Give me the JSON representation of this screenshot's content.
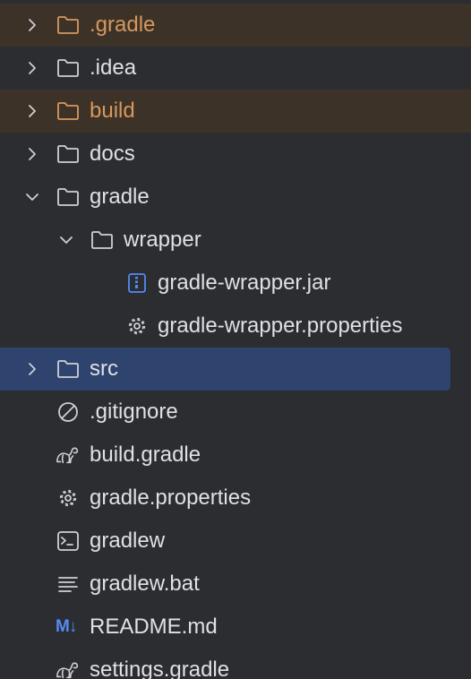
{
  "colors": {
    "background": "#2b2d30",
    "text": "#dfe1e5",
    "excluded_text": "#d6985e",
    "excluded_row": "#3d3228",
    "selected_row": "#2e436e",
    "icon": "#ced0d6",
    "accent": "#548af7"
  },
  "tree": {
    "items": [
      {
        "label": ".gradle",
        "icon": "folder-icon",
        "state": "excluded",
        "expanded": false
      },
      {
        "label": ".idea",
        "icon": "folder-icon",
        "state": "normal",
        "expanded": false
      },
      {
        "label": "build",
        "icon": "folder-icon",
        "state": "excluded",
        "expanded": false
      },
      {
        "label": "docs",
        "icon": "folder-icon",
        "state": "normal",
        "expanded": false
      },
      {
        "label": "gradle",
        "icon": "folder-icon",
        "state": "normal",
        "expanded": true
      },
      {
        "label": "wrapper",
        "icon": "folder-icon",
        "state": "normal",
        "expanded": true
      },
      {
        "label": "gradle-wrapper.jar",
        "icon": "archive-icon",
        "state": "normal"
      },
      {
        "label": "gradle-wrapper.properties",
        "icon": "gear-icon",
        "state": "normal"
      },
      {
        "label": "src",
        "icon": "folder-icon",
        "state": "selected",
        "expanded": false
      },
      {
        "label": ".gitignore",
        "icon": "ignore-icon",
        "state": "normal"
      },
      {
        "label": "build.gradle",
        "icon": "gradle-elephant-icon",
        "state": "normal"
      },
      {
        "label": "gradle.properties",
        "icon": "gear-icon",
        "state": "normal"
      },
      {
        "label": "gradlew",
        "icon": "terminal-icon",
        "state": "normal"
      },
      {
        "label": "gradlew.bat",
        "icon": "text-file-icon",
        "state": "normal"
      },
      {
        "label": "README.md",
        "icon": "markdown-icon",
        "icon_text": "M↓",
        "state": "normal"
      },
      {
        "label": "settings.gradle",
        "icon": "gradle-elephant-icon",
        "state": "normal"
      }
    ]
  }
}
